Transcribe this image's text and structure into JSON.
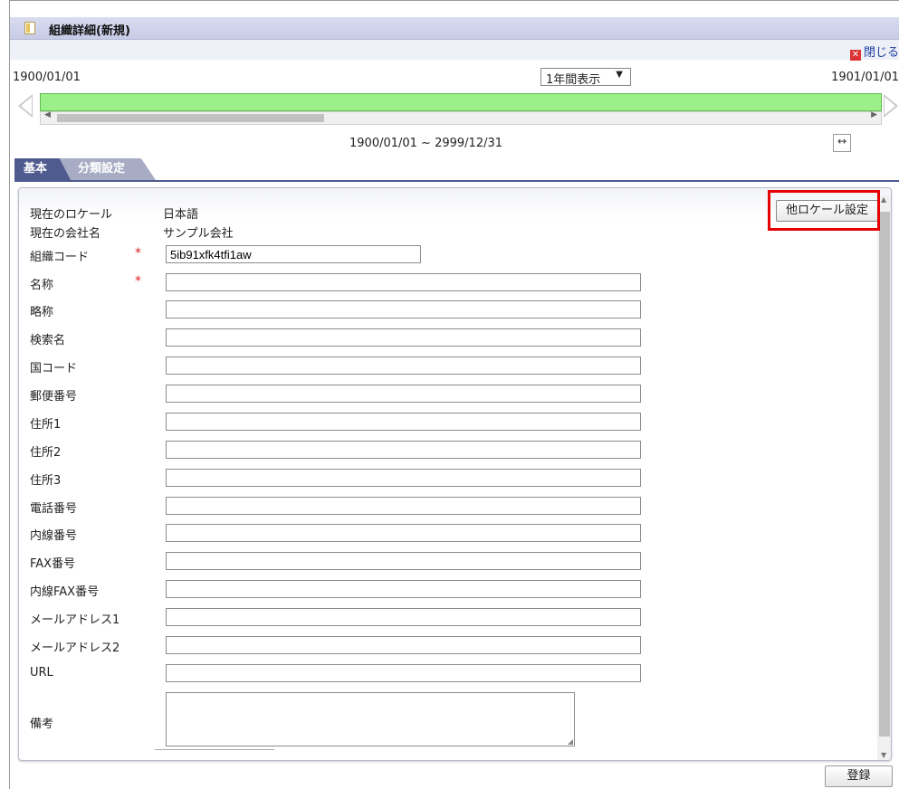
{
  "window": {
    "title": "組織詳細(新規)",
    "close_label": "閉じる"
  },
  "timeline": {
    "start_date": "1900/01/01",
    "end_date": "1901/01/01",
    "period_select": "1年間表示",
    "range_text": "1900/01/01 ~ 2999/12/31"
  },
  "tabs": [
    {
      "label": "基本"
    },
    {
      "label": "分類設定"
    }
  ],
  "form": {
    "locale_label": "現在のロケール",
    "locale_value": "日本語",
    "company_label": "現在の会社名",
    "company_value": "サンプル会社",
    "other_locale_button": "他ロケール設定",
    "fields": [
      {
        "label": "組織コード",
        "value": "5ib91xfk4tfi1aw",
        "required": "*"
      },
      {
        "label": "名称",
        "value": "",
        "required": "*"
      },
      {
        "label": "略称",
        "value": ""
      },
      {
        "label": "検索名",
        "value": ""
      },
      {
        "label": "国コード",
        "value": ""
      },
      {
        "label": "郵便番号",
        "value": ""
      },
      {
        "label": "住所1",
        "value": ""
      },
      {
        "label": "住所2",
        "value": ""
      },
      {
        "label": "住所3",
        "value": ""
      },
      {
        "label": "電話番号",
        "value": ""
      },
      {
        "label": "内線番号",
        "value": ""
      },
      {
        "label": "FAX番号",
        "value": ""
      },
      {
        "label": "内線FAX番号",
        "value": ""
      },
      {
        "label": "メールアドレス1",
        "value": ""
      },
      {
        "label": "メールアドレス2",
        "value": ""
      },
      {
        "label": "URL",
        "value": ""
      },
      {
        "label": "備考",
        "value": ""
      }
    ]
  },
  "footer": {
    "register_button": "登録"
  },
  "colors": {
    "timeline": "#9cf08a",
    "tab_active": "#4f5b8f",
    "highlight": "#e60000"
  }
}
